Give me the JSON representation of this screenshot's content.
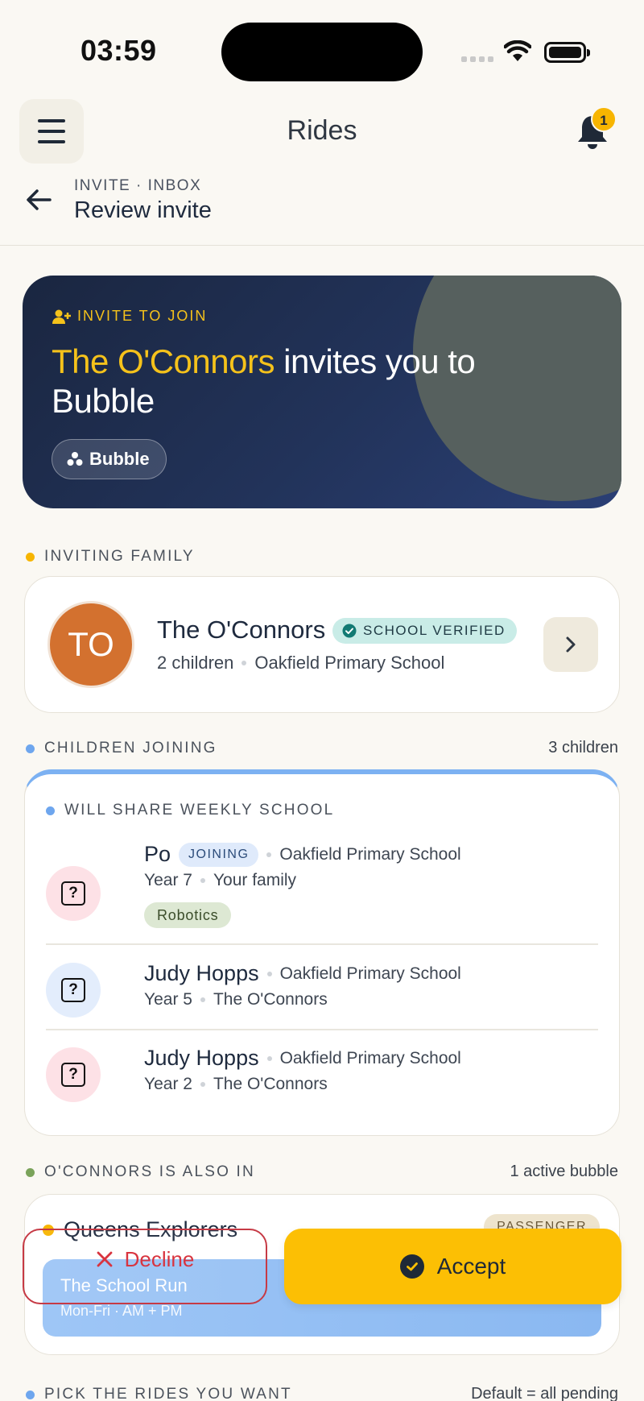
{
  "status_bar": {
    "time": "03:59"
  },
  "header": {
    "title": "Rides",
    "notification_count": "1"
  },
  "subheader": {
    "crumb": "INVITE · INBOX",
    "title": "Review invite"
  },
  "hero": {
    "kicker": "INVITE TO JOIN",
    "inviter": "The O'Connors",
    "text_rest": " invites you to Bubble",
    "chip": "Bubble"
  },
  "inviting_family": {
    "section_label": "INVITING FAMILY",
    "initials": "TO",
    "name": "The O'Connors",
    "badge": "SCHOOL VERIFIED",
    "children_count": "2 children",
    "school": "Oakfield Primary School"
  },
  "children": {
    "section_label": "CHILDREN JOINING",
    "count_label": "3 children",
    "sub_label": "WILL SHARE WEEKLY SCHOOL",
    "items": [
      {
        "name": "Po",
        "badge": "JOINING",
        "school": "Oakfield Primary School",
        "year": "Year 7",
        "family": "Your family",
        "tag": "Robotics"
      },
      {
        "name": "Judy Hopps",
        "school": "Oakfield Primary School",
        "year": "Year 5",
        "family": "The O'Connors"
      },
      {
        "name": "Judy Hopps",
        "school": "Oakfield Primary School",
        "year": "Year 2",
        "family": "The O'Connors"
      }
    ]
  },
  "bubbles": {
    "section_label": "O'CONNORS IS ALSO IN",
    "count_label": "1 active bubble",
    "items": [
      {
        "name": "Queens Explorers",
        "role": "PASSENGER",
        "run_title": "The School Run",
        "run_time": "Mon-Fri · AM + PM"
      }
    ]
  },
  "rides": {
    "section_label": "PICK THE RIDES YOU WANT",
    "default_label": "Default = all pending"
  },
  "actions": {
    "decline": "Decline",
    "accept": "Accept"
  },
  "colors": {
    "accent_yellow": "#fcbf04",
    "decline_red": "#d8343f",
    "hero_navy": "#1a2640",
    "family_avatar": "#d3712f",
    "children_accent": "#7cb1f2"
  },
  "icons": {
    "menu": "hamburger-icon",
    "bell": "bell-icon",
    "back": "arrow-left-icon",
    "invite": "person-add-icon",
    "bubble": "bubble-cluster-icon",
    "verified": "verified-check-icon",
    "chevron": "chevron-right-icon",
    "child_placeholder": "question-box-icon",
    "decline": "x-icon",
    "accept": "check-circle-icon"
  }
}
